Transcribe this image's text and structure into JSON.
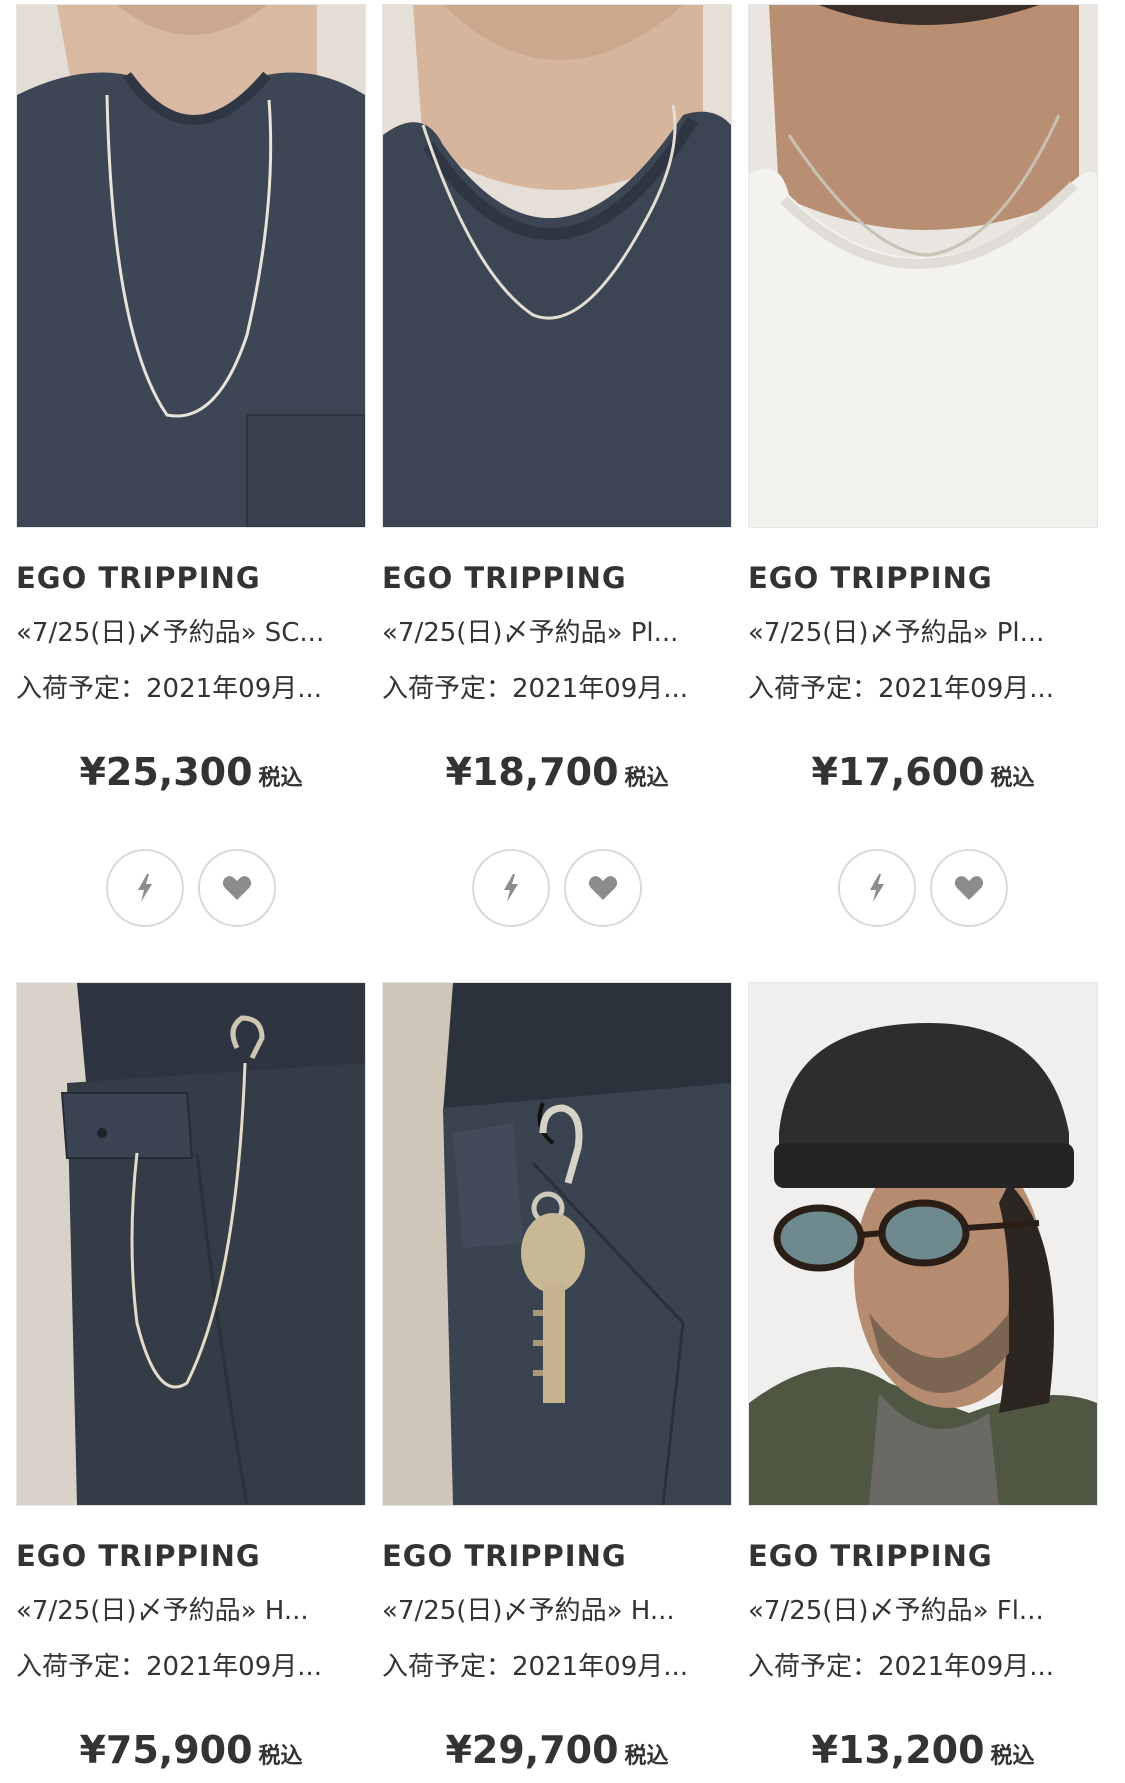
{
  "products": [
    {
      "brand": "EGO TRIPPING",
      "name": "«7/25(日)〆予約品» SC...",
      "arrival": "入荷予定：2021年09月...",
      "price": "¥25,300",
      "tax_label": "税込",
      "image_subject": "man in navy pocket t-shirt wearing long silver snake chain necklace"
    },
    {
      "brand": "EGO TRIPPING",
      "name": "«7/25(日)〆予約品» Pl...",
      "arrival": "入荷予定：2021年09月...",
      "price": "¥18,700",
      "tax_label": "税込",
      "image_subject": "man in navy t-shirt wearing silver rope chain necklace"
    },
    {
      "brand": "EGO TRIPPING",
      "name": "«7/25(日)〆予約品» Pl...",
      "arrival": "入荷予定：2021年09月...",
      "price": "¥17,600",
      "tax_label": "税込",
      "image_subject": "man in white t-shirt wearing short silver chain necklace"
    },
    {
      "brand": "EGO TRIPPING",
      "name": "«7/25(日)〆予約品» H...",
      "arrival": "入荷予定：2021年09月...",
      "price": "¥75,900",
      "tax_label": "税込",
      "image_subject": "navy cargo pants with long silver wallet chain and shackle hook"
    },
    {
      "brand": "EGO TRIPPING",
      "name": "«7/25(日)〆予約品» H...",
      "arrival": "入荷予定：2021年09月...",
      "price": "¥29,700",
      "tax_label": "税込",
      "image_subject": "navy pants with silver shackle keyring holding a brass key"
    },
    {
      "brand": "EGO TRIPPING",
      "name": "«7/25(日)〆予約品» Fl...",
      "arrival": "入荷予定：2021年09月...",
      "price": "¥13,200",
      "tax_label": "税込",
      "image_subject": "man in black knit watch cap, dark sunglasses and olive jacket"
    }
  ],
  "icons": {
    "quick_buy": "lightning-icon",
    "favorite": "heart-icon"
  },
  "colors": {
    "text": "#333333",
    "icon": "#8c8c8c",
    "button_border": "#d9d9d9",
    "image_border": "#e6e6e6"
  }
}
